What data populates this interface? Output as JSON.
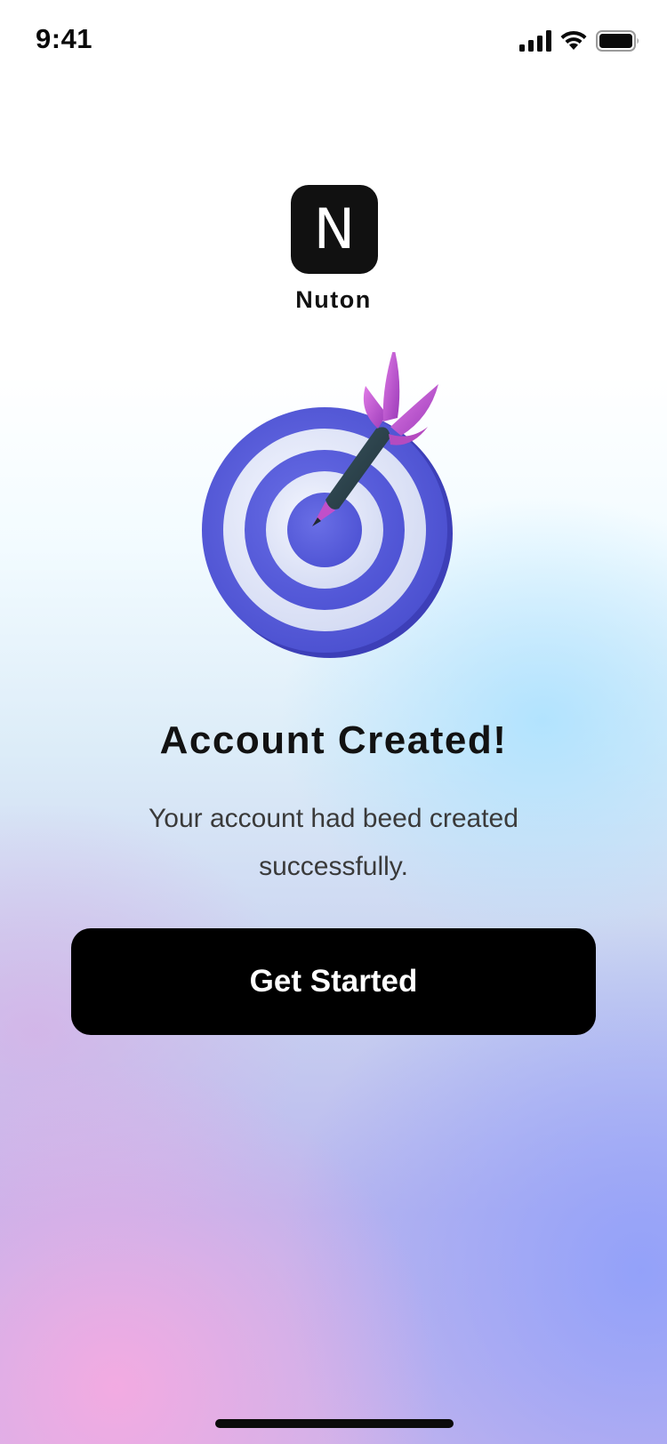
{
  "status_bar": {
    "time": "9:41",
    "icons": [
      "cellular-signal-icon",
      "wifi-icon",
      "battery-icon"
    ]
  },
  "brand": {
    "logo_letter": "N",
    "name": "Nuton"
  },
  "illustration": {
    "icon": "target-with-dart-icon"
  },
  "content": {
    "title": "Account Created!",
    "message": "Your account had beed created successfully."
  },
  "actions": {
    "primary_label": "Get Started"
  },
  "colors": {
    "button_bg": "#000000",
    "button_text": "#ffffff",
    "target_blue": "#5a5fdc",
    "dart_pink": "#c14fc9"
  }
}
